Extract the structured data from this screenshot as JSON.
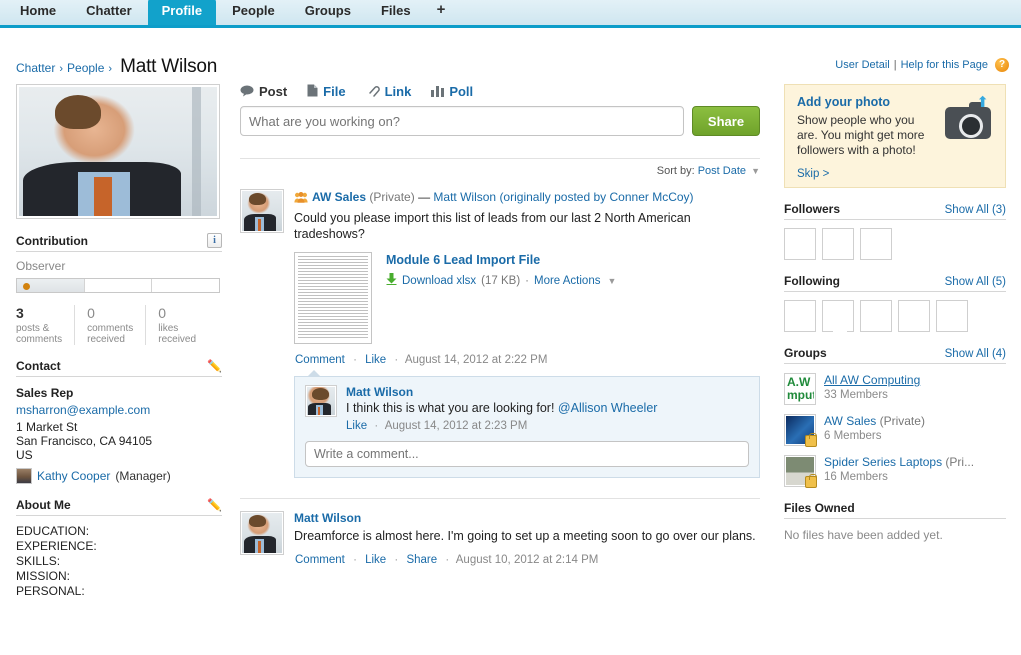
{
  "nav": {
    "tabs": [
      {
        "label": "Home",
        "active": false
      },
      {
        "label": "Chatter",
        "active": false
      },
      {
        "label": "Profile",
        "active": true
      },
      {
        "label": "People",
        "active": false
      },
      {
        "label": "Groups",
        "active": false
      },
      {
        "label": "Files",
        "active": false
      }
    ],
    "add_tab_label": "+"
  },
  "breadcrumb": {
    "root": "Chatter",
    "sep1": "›",
    "section": "People",
    "sep2": "›",
    "name": "Matt Wilson"
  },
  "toplinks": {
    "user_detail": "User Detail",
    "divider": "|",
    "help": "Help for this Page",
    "help_badge": "?"
  },
  "left": {
    "contribution": {
      "title": "Contribution",
      "info_icon": "i",
      "level": "Observer",
      "segments": 3,
      "filled_segments": 1
    },
    "stats": [
      {
        "value": "3",
        "label": "posts &\ncomments",
        "is_zero": false
      },
      {
        "value": "0",
        "label": "comments\nreceived",
        "is_zero": true
      },
      {
        "value": "0",
        "label": "likes\nreceived",
        "is_zero": true
      }
    ],
    "contact": {
      "title": "Contact",
      "edit_icon": "✏️",
      "role": "Sales Rep",
      "email": "msharron@example.com",
      "street": "1 Market St",
      "city_state_zip": "San Francisco, CA 94105",
      "country": "US",
      "manager_name": "Kathy Cooper",
      "manager_title": "(Manager)"
    },
    "about": {
      "title": "About Me",
      "edit_icon": "✏️",
      "lines": [
        "EDUCATION:",
        "EXPERIENCE:",
        "SKILLS:",
        "MISSION:",
        "PERSONAL:"
      ]
    }
  },
  "composer": {
    "tabs": [
      {
        "label": "Post",
        "icon": "speech-bubble-icon",
        "glyph": "💬",
        "active": true
      },
      {
        "label": "File",
        "icon": "file-icon",
        "glyph": "🗋",
        "active": false
      },
      {
        "label": "Link",
        "icon": "link-icon",
        "glyph": "🔗",
        "active": false
      },
      {
        "label": "Poll",
        "icon": "bar-chart-icon",
        "glyph": "▃",
        "active": false
      }
    ],
    "placeholder": "What are you working on?",
    "value": "",
    "share_label": "Share"
  },
  "sort": {
    "prefix": "Sort by:",
    "value": "Post Date",
    "caret": "▼"
  },
  "feed": [
    {
      "group_icon": "group-icon",
      "group_name": "AW Sales",
      "group_privacy": "(Private)",
      "dash": "—",
      "recipient": "Matt Wilson",
      "origin_prefix": "(originally posted by",
      "origin_author": "Conner McCoy",
      "origin_suffix": ")",
      "text": "Could you please import this list of leads from our last 2 North American tradeshows?",
      "attachment": {
        "title": "Module 6 Lead Import File",
        "download_label": "Download xlsx",
        "size": "(17 KB)",
        "separator": "·",
        "more_actions": "More Actions",
        "caret": "▼"
      },
      "actions": [
        "Comment",
        "Like"
      ],
      "timestamp": "August 14, 2012 at 2:22 PM",
      "comments": [
        {
          "author": "Matt Wilson",
          "text_before_mention": "I think this is what you are looking for! ",
          "mention": "@Allison Wheeler",
          "action": "Like",
          "timestamp": "August 14, 2012 at 2:23 PM"
        }
      ],
      "comment_placeholder": "Write a comment..."
    },
    {
      "author": "Matt Wilson",
      "text": "Dreamforce is almost here. I'm going to set up a meeting soon to go over our plans.",
      "actions": [
        "Comment",
        "Like",
        "Share"
      ],
      "timestamp": "August 10, 2012 at 2:14 PM"
    }
  ],
  "right": {
    "promo": {
      "title": "Add your photo",
      "body": "Show people who you are. You might get more followers with a photo!",
      "skip": "Skip >",
      "camera_icon": "camera-upload-icon"
    },
    "followers": {
      "title": "Followers",
      "show_all": "Show All (3)",
      "avatars": [
        "a1",
        "a2",
        "a3"
      ]
    },
    "following": {
      "title": "Following",
      "show_all": "Show All (5)",
      "avatars": [
        "a1",
        "a4",
        "a5",
        "a6",
        "a7"
      ]
    },
    "groups": {
      "title": "Groups",
      "show_all": "Show All (4)",
      "items": [
        {
          "name": "All AW Computing",
          "privacy": "",
          "members": "33 Members",
          "thumb": "g1",
          "thumb_text": "A.W\nmputin",
          "locked": false,
          "underlined": true
        },
        {
          "name": "AW Sales",
          "privacy": "(Private)",
          "members": "6 Members",
          "thumb": "g2",
          "thumb_text": "",
          "locked": true,
          "underlined": false
        },
        {
          "name": "Spider Series Laptops",
          "privacy": "(Pri...",
          "members": "16 Members",
          "thumb": "g3",
          "thumb_text": "",
          "locked": true,
          "underlined": false
        }
      ]
    },
    "files": {
      "title": "Files Owned",
      "empty": "No files have been added yet."
    }
  }
}
